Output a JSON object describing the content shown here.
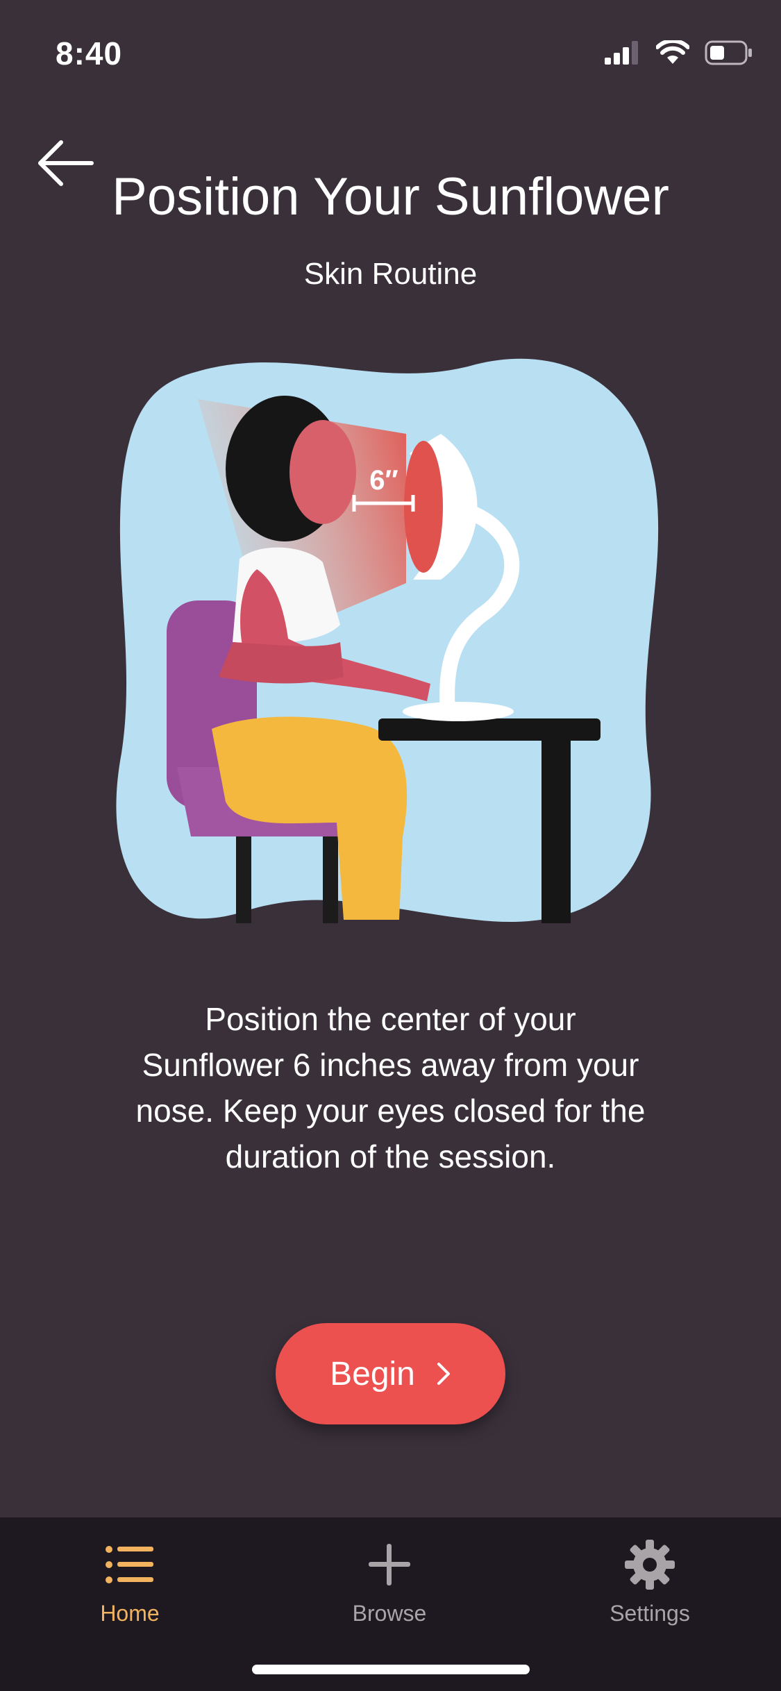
{
  "status_bar": {
    "time": "8:40"
  },
  "header": {
    "back_icon": "arrow-left-icon",
    "title": "Position Your Sunflower",
    "subtitle": "Skin Routine"
  },
  "illustration": {
    "distance_label": "6″"
  },
  "instructions": "Position the center of your Sunflower 6 inches away from your nose. Keep your eyes closed for the duration of the session.",
  "begin_button": {
    "label": "Begin",
    "icon": "chevron-right-icon"
  },
  "tab_bar": {
    "active_color": "#f3b35e",
    "inactive_color": "#a9a4a8",
    "tabs": [
      {
        "label": "Home",
        "icon": "list-icon",
        "active": true
      },
      {
        "label": "Browse",
        "icon": "plus-icon",
        "active": false
      },
      {
        "label": "Settings",
        "icon": "gear-icon",
        "active": false
      }
    ]
  },
  "colors": {
    "background": "#3a303a",
    "accent": "#ec5150",
    "tab_bar_bg": "#1e1820"
  }
}
